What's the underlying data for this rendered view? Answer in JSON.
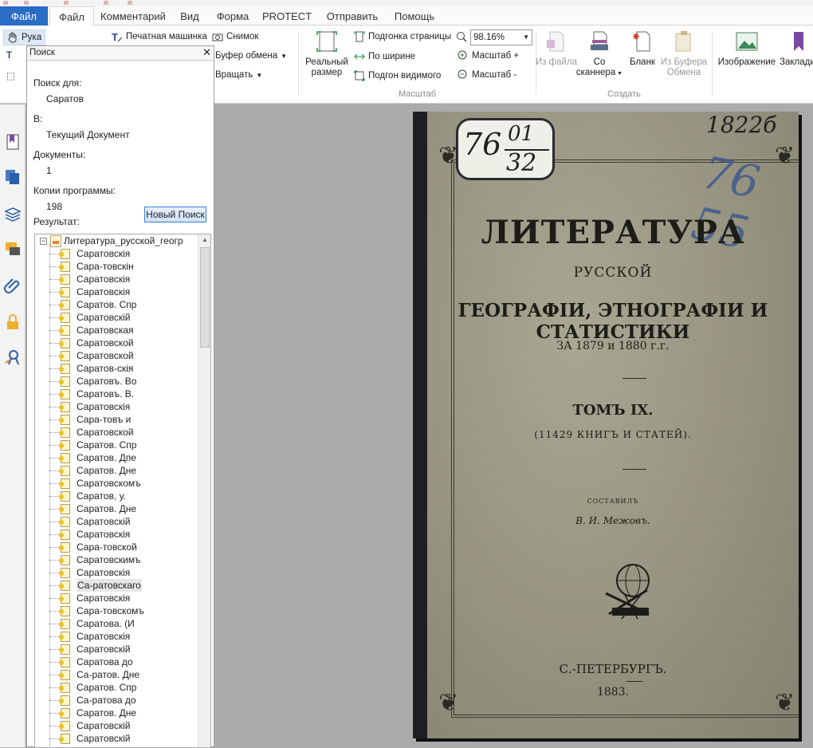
{
  "colors": {
    "file_tab": "#2b6cc4",
    "accent_button": "#3c7fd6",
    "page_bg": "#ababab"
  },
  "tabs": [
    {
      "label": "Файл"
    },
    {
      "label": "Файл"
    },
    {
      "label": "Комментарий"
    },
    {
      "label": "Вид"
    },
    {
      "label": "Форма"
    },
    {
      "label": "PROTECT"
    },
    {
      "label": "Отправить"
    },
    {
      "label": "Помощь"
    }
  ],
  "ribbon": {
    "hand": "Рука",
    "typewriter": "Печатная машинка",
    "snapshot": "Снимок",
    "clipboard": "Буфер обмена",
    "rotate": "Вращать",
    "actual_size": "Реальный размер",
    "fit_page": "Подгонка страницы",
    "fit_width": "По ширине",
    "fit_visible": "Подгон видимого",
    "zoom_value": "98.16%",
    "zoom_in": "Масштаб +",
    "zoom_out": "Масштаб -",
    "group_zoom": "Масштаб",
    "from_file": "Из файла",
    "from_scanner": "Со сканнера",
    "blank": "Бланк",
    "from_clipboard": "Из Буфера Обмена",
    "group_create": "Создать",
    "image": "Изображение",
    "bookmark": "Заклади"
  },
  "search_panel": {
    "title": "Поиск",
    "search_for_label": "Поиск для:",
    "search_for_value": "Саратов",
    "in_label": "В:",
    "in_value": "Текущий Документ",
    "documents_label": "Документы:",
    "documents_value": "1",
    "copies_label": "Копии программы:",
    "copies_value": "198",
    "new_search": "Новый Поиск",
    "results_label": "Результат:",
    "root_file": "Литература_русской_геогр",
    "results": [
      "Саратовскія",
      "Сара-товскін",
      "Саратовскія",
      "Саратовскія",
      "Саратов. Спр",
      "Саратовскій",
      "Саратовская",
      "Саратовской",
      "Саратовской",
      "Саратов-скія",
      "Саратовъ. Во",
      "Саратовъ. В.",
      "Саратовскія",
      "Сара-товъ и",
      "Саратовской",
      "Саратов. Спр",
      "Саратов. Дпе",
      "Саратов. Дне",
      "Саратовскомъ",
      "Саратов, у.",
      "Саратов. Дне",
      "Саратовскій",
      "Саратовскія",
      "Сара-товской",
      "Саратовскимъ",
      "Саратовскія",
      "Са-ратовскаго",
      "Саратовскія",
      "Сара-товскомъ",
      "Саратова. (И",
      "Саратовскія",
      "Саратовскій",
      "Саратова до",
      "Са-ратов. Дне",
      "Саратов. Спр",
      "Са-ратова до",
      "Саратов. Дне",
      "Саратовскій",
      "Саратовскій"
    ],
    "selected_index": 26
  },
  "document": {
    "label_left": "76",
    "label_top": "01",
    "label_bottom": "32",
    "handwritten_top": "1822б",
    "handwritten_blue": "76 55",
    "title": "ЛИТЕРАТУРА",
    "subtitle1": "РУССКОЙ",
    "subtitle2": "ГЕОГРАФІИ, ЭТНОГРАФІИ И СТАТИСТИКИ",
    "years": "ЗА 1879 и 1880 г.г.",
    "volume": "ТОМЪ IX.",
    "count": "(11429 КНИГЪ И СТАТЕЙ).",
    "compiled": "СОСТАВИЛЪ",
    "author": "В. И. Межовъ.",
    "city": "С.-ПЕТЕРБУРГЪ.",
    "year": "1883."
  }
}
